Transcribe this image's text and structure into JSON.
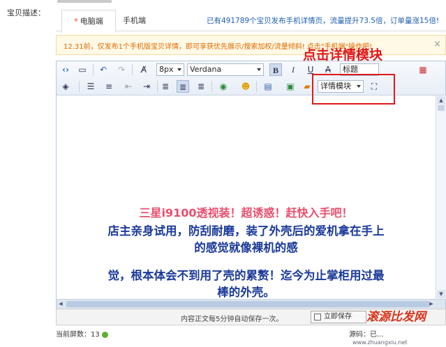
{
  "form": {
    "label": "宝贝描述："
  },
  "tabs": [
    {
      "star": "*",
      "label": "电脑端"
    },
    {
      "label": "手机端"
    }
  ],
  "promo": "已有491789个宝贝发布手机详情页，流量提升73.5倍，订单量涨15倍!",
  "notice": {
    "text": "12.31前，仅发布1个手机版宝贝详情，即可享获优先展示/搜索加权/流量倾斜! 点击\"手机端\"操作吧!",
    "close": "×"
  },
  "toolbar": {
    "font_size": "8px",
    "font_family": "Verdana",
    "bold": "B",
    "italic": "I",
    "underline": "U",
    "strike": "A",
    "heading": "标题",
    "detail_module": "详情模块"
  },
  "annotation": "点击详情模块",
  "content": {
    "line1": "三星i9100透视装！超诱惑！赶快入手吧！",
    "line2": "店主亲身试用，防刮耐磨，装了外壳后的爱机拿在手上",
    "line3": "的感觉就像裸机的感",
    "line4": "觉，根本体会不到用了壳的累赘！迄今为止掌柜用过最",
    "line5": "棒的外壳。"
  },
  "status": {
    "autosave": "内容正文每5分钟自动保存一次。",
    "save_button": "立即保存"
  },
  "footer": {
    "screens": "当前屏数：13",
    "source": "源码：已..."
  },
  "watermark": {
    "brand": "滚源比发网",
    "url": "www.zhuangxiu.net"
  },
  "colors": {
    "accent_red": "#e0181a",
    "link_blue": "#1f5fae",
    "pink": "#ea4e6c",
    "navy": "#1b3a9a"
  }
}
